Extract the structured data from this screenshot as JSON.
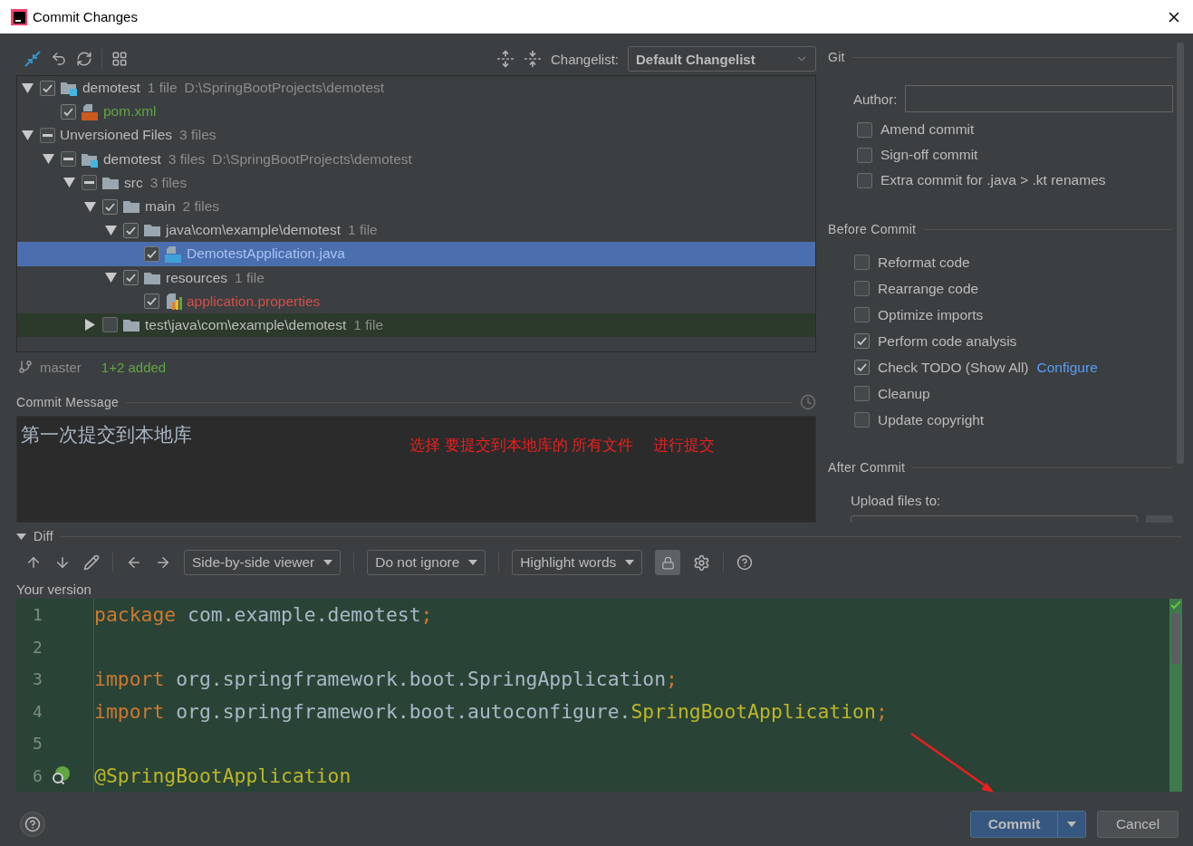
{
  "window": {
    "title": "Commit Changes"
  },
  "changelist": {
    "label": "Changelist:",
    "value": "Default Changelist"
  },
  "tree": [
    {
      "kind": "module",
      "name": "demotest",
      "count": "1 file",
      "path": "D:\\SpringBootProjects\\demotest",
      "checked": true,
      "indeterminate": false,
      "expanded": true,
      "selected": false,
      "highlighted": false,
      "children": [
        {
          "kind": "xml",
          "name": "pom.xml",
          "color": "#62a543",
          "checked": true,
          "indeterminate": false,
          "selected": false,
          "highlighted": false
        }
      ]
    },
    {
      "kind": "group",
      "name": "Unversioned Files",
      "count": "3 files",
      "checked": false,
      "indeterminate": true,
      "expanded": true,
      "selected": false,
      "highlighted": false,
      "children": [
        {
          "kind": "module",
          "name": "demotest",
          "count": "3 files",
          "path": "D:\\SpringBootProjects\\demotest",
          "checked": false,
          "indeterminate": true,
          "expanded": true,
          "selected": false,
          "highlighted": false,
          "children": [
            {
              "kind": "folder",
              "name": "src",
              "count": "3 files",
              "checked": false,
              "indeterminate": true,
              "expanded": true,
              "selected": false,
              "highlighted": false,
              "children": [
                {
                  "kind": "folder",
                  "name": "main",
                  "count": "2 files",
                  "checked": true,
                  "indeterminate": false,
                  "expanded": true,
                  "selected": false,
                  "highlighted": false,
                  "children": [
                    {
                      "kind": "folder",
                      "name": "java\\com\\example\\demotest",
                      "count": "1 file",
                      "checked": true,
                      "indeterminate": false,
                      "expanded": true,
                      "selected": false,
                      "highlighted": false,
                      "children": [
                        {
                          "kind": "java",
                          "name": "DemotestApplication.java",
                          "color": "#a9c2f0",
                          "checked": true,
                          "indeterminate": false,
                          "selected": true,
                          "highlighted": false
                        }
                      ]
                    },
                    {
                      "kind": "folder",
                      "name": "resources",
                      "count": "1 file",
                      "checked": true,
                      "indeterminate": false,
                      "expanded": true,
                      "selected": false,
                      "highlighted": false,
                      "children": [
                        {
                          "kind": "properties",
                          "name": "application.properties",
                          "color": "#d1504a",
                          "checked": true,
                          "indeterminate": false,
                          "selected": false,
                          "highlighted": false
                        }
                      ]
                    }
                  ]
                },
                {
                  "kind": "folder",
                  "name": "test\\java\\com\\example\\demotest",
                  "count": "1 file",
                  "checked": false,
                  "indeterminate": false,
                  "expanded": false,
                  "selected": false,
                  "highlighted": true
                }
              ]
            }
          ]
        }
      ]
    }
  ],
  "status": {
    "branch": "master",
    "summary": "1+2 added"
  },
  "commit_message": {
    "label": "Commit Message",
    "value": "第一次提交到本地库",
    "annotation": "选择 要提交到本地库的 所有文件　 进行提交"
  },
  "git": {
    "title": "Git",
    "author_label": "Author:",
    "options": [
      {
        "label": "Amend commit",
        "checked": false
      },
      {
        "label": "Sign-off commit",
        "checked": false
      },
      {
        "label": "Extra commit for .java > .kt renames",
        "checked": false
      }
    ]
  },
  "before_commit": {
    "title": "Before Commit",
    "options": [
      {
        "label": "Reformat code",
        "checked": false
      },
      {
        "label": "Rearrange code",
        "checked": false
      },
      {
        "label": "Optimize imports",
        "checked": false
      },
      {
        "label": "Perform code analysis",
        "checked": true
      },
      {
        "label": "Check TODO (Show All)",
        "checked": true,
        "link": "Configure"
      },
      {
        "label": "Cleanup",
        "checked": false
      },
      {
        "label": "Update copyright",
        "checked": false
      }
    ]
  },
  "after_commit": {
    "title": "After Commit",
    "upload_label": "Upload files to:"
  },
  "diff": {
    "title": "Diff",
    "expanded": true,
    "dropdowns": [
      "Side-by-side viewer",
      "Do not ignore",
      "Highlight words"
    ],
    "lock_on": true,
    "version_label": "Your version",
    "lines": [
      {
        "number": "1",
        "marker": false,
        "tokens": [
          {
            "kind": "keyword",
            "text": "package "
          },
          {
            "kind": "plain",
            "text": "com.example.demotest"
          },
          {
            "kind": "keyword",
            "text": ";"
          }
        ]
      },
      {
        "number": "2",
        "marker": false
      },
      {
        "number": "3",
        "marker": false,
        "tokens": [
          {
            "kind": "keyword",
            "text": "import "
          },
          {
            "kind": "plain",
            "text": "org.springframework.boot.SpringApplication"
          },
          {
            "kind": "keyword",
            "text": ";"
          }
        ]
      },
      {
        "number": "4",
        "marker": false,
        "tokens": [
          {
            "kind": "keyword",
            "text": "import "
          },
          {
            "kind": "plain",
            "text": "org.springframework.boot.autoconfigure."
          },
          {
            "kind": "annotation",
            "text": "SpringBootApplication"
          },
          {
            "kind": "keyword",
            "text": ";"
          }
        ]
      },
      {
        "number": "5",
        "marker": false
      },
      {
        "number": "6",
        "marker": true,
        "tokens": [
          {
            "kind": "annotation",
            "text": "@SpringBootApplication"
          }
        ]
      }
    ]
  },
  "buttons": {
    "commit": "Commit",
    "cancel": "Cancel"
  }
}
